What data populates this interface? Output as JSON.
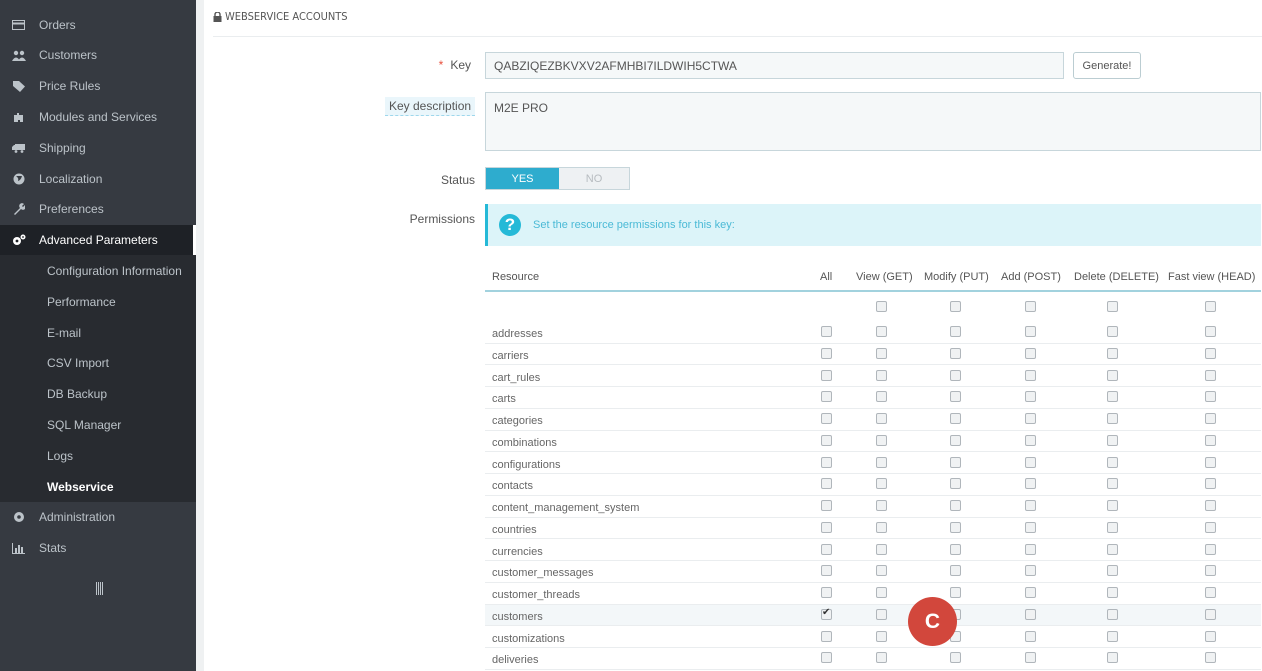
{
  "sidebar": {
    "items": [
      {
        "label": "Orders",
        "icon": "credit-card-icon"
      },
      {
        "label": "Customers",
        "icon": "users-icon"
      },
      {
        "label": "Price Rules",
        "icon": "tag-icon"
      },
      {
        "label": "Modules and Services",
        "icon": "puzzle-icon"
      },
      {
        "label": "Shipping",
        "icon": "truck-icon"
      },
      {
        "label": "Localization",
        "icon": "globe-icon"
      },
      {
        "label": "Preferences",
        "icon": "wrench-icon"
      },
      {
        "label": "Advanced Parameters",
        "icon": "cogs-icon"
      }
    ],
    "subitems": [
      "Configuration Information",
      "Performance",
      "E-mail",
      "CSV Import",
      "DB Backup",
      "SQL Manager",
      "Logs",
      "Webservice"
    ],
    "items_after": [
      {
        "label": "Administration",
        "icon": "gear-icon"
      },
      {
        "label": "Stats",
        "icon": "bar-chart-icon"
      }
    ]
  },
  "panel": {
    "title": "WEBSERVICE ACCOUNTS",
    "key_label": "Key",
    "key_required_mark": "*",
    "key_value": "QABZIQEZBKVXV2AFMHBI7ILDWIH5CTWA",
    "generate_label": "Generate!",
    "desc_label": "Key description",
    "desc_value": "M2E PRO",
    "status_label": "Status",
    "status_yes": "YES",
    "status_no": "NO",
    "permissions_label": "Permissions",
    "permissions_info": "Set the resource permissions for this key:"
  },
  "table": {
    "headers": [
      "Resource",
      "All",
      "View (GET)",
      "Modify (PUT)",
      "Add (POST)",
      "Delete (DELETE)",
      "Fast view (HEAD)"
    ],
    "rows": [
      {
        "name": "addresses",
        "checked": []
      },
      {
        "name": "carriers",
        "checked": []
      },
      {
        "name": "cart_rules",
        "checked": []
      },
      {
        "name": "carts",
        "checked": []
      },
      {
        "name": "categories",
        "checked": []
      },
      {
        "name": "combinations",
        "checked": []
      },
      {
        "name": "configurations",
        "checked": []
      },
      {
        "name": "contacts",
        "checked": []
      },
      {
        "name": "content_management_system",
        "checked": []
      },
      {
        "name": "countries",
        "checked": []
      },
      {
        "name": "currencies",
        "checked": []
      },
      {
        "name": "customer_messages",
        "checked": []
      },
      {
        "name": "customer_threads",
        "checked": []
      },
      {
        "name": "customers",
        "checked": [
          1
        ],
        "highlight": true
      },
      {
        "name": "customizations",
        "checked": []
      },
      {
        "name": "deliveries",
        "checked": []
      }
    ]
  },
  "marker": {
    "label": "C",
    "color": "#d2473c"
  },
  "colors": {
    "sidebar": "#363a41",
    "accent": "#25b9d7",
    "toggle_on": "#2eacce"
  }
}
